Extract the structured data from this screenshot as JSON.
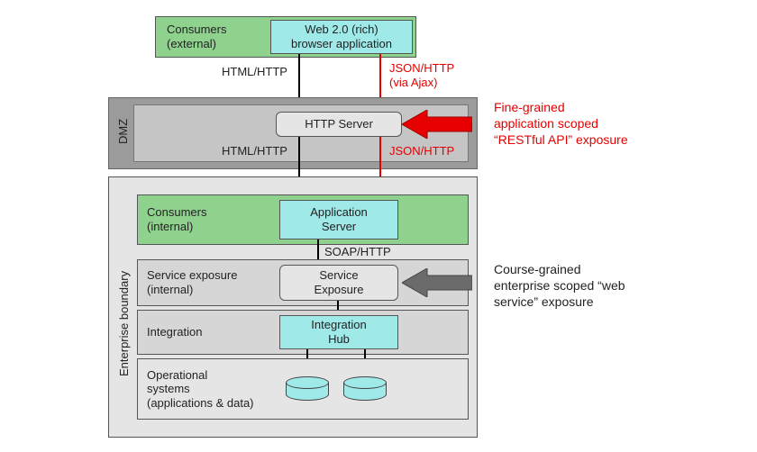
{
  "top": {
    "consumers_external": "Consumers\n(external)",
    "browser_app": "Web 2.0 (rich)\nbrowser application"
  },
  "conn": {
    "html_http_1": "HTML/HTTP",
    "json_http_ajax": "JSON/HTTP\n(via Ajax)",
    "html_http_2": "HTML/HTTP",
    "json_http_2": "JSON/HTTP",
    "soap_http": "SOAP/HTTP"
  },
  "dmz": {
    "label": "DMZ",
    "http_server": "HTTP Server"
  },
  "enterprise": {
    "label": "Enterprise boundary",
    "rows": {
      "consumers_internal": "Consumers\n(internal)",
      "service_exposure_internal": "Service exposure\n(internal)",
      "integration": "Integration",
      "operational": "Operational\nsystems\n(applications & data)"
    },
    "nodes": {
      "app_server": "Application\nServer",
      "service_exposure": "Service\nExposure",
      "integration_hub": "Integration\nHub"
    }
  },
  "annotations": {
    "fine_grained": "Fine-grained\napplication scoped\n“RESTful API” exposure",
    "course_grained": "Course-grained\nenterprise scoped “web\nservice” exposure"
  },
  "colors": {
    "green": "#8ed28e",
    "cyan": "#9fe9e9",
    "dmz": "#c5c5c5",
    "dmz_dark": "#9b9b9b",
    "panel": "#e5e5e5",
    "row": "#d6d6d6",
    "red": "#e60000",
    "gray_arrow": "#6b6b6b"
  }
}
